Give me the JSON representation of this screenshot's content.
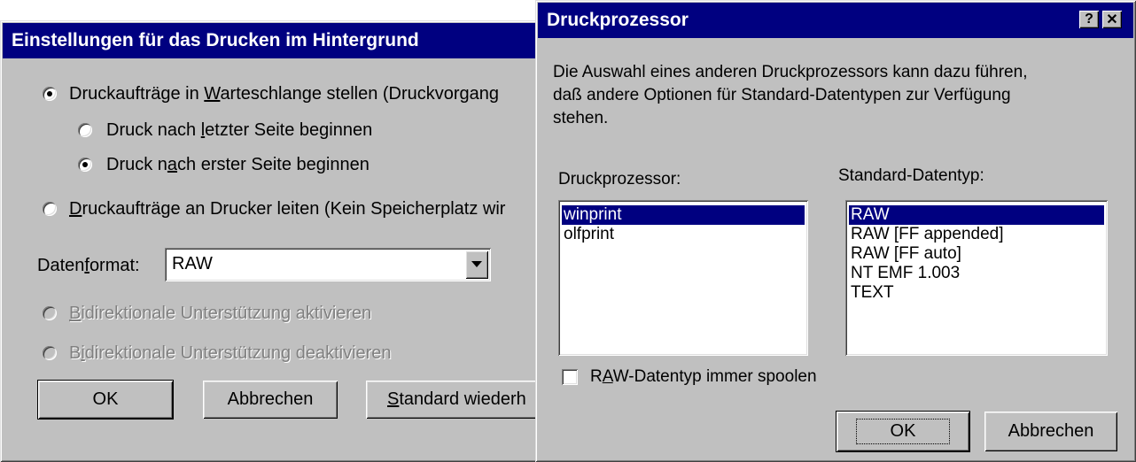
{
  "left_dialog": {
    "title": "Einstellungen für das Drucken im Hintergrund",
    "radio_spool": {
      "pre": "Druckaufträge in ",
      "acc": "W",
      "post": "arteschlange stellen (Druckvorgang"
    },
    "radio_after_last": {
      "pre": "Druck nach ",
      "acc": "l",
      "post": "etzter Seite beginnen"
    },
    "radio_after_first": {
      "pre": "Druck n",
      "acc": "a",
      "post": "ch erster Seite  beginnen"
    },
    "radio_direct": {
      "pre": "",
      "acc": "D",
      "post": "ruckaufträge an Drucker leiten (Kein Speicherplatz wir"
    },
    "format_label": {
      "pre": "Daten",
      "acc": "f",
      "post": "ormat:"
    },
    "format_value": "RAW",
    "bidi_enable": {
      "pre": "",
      "acc": "B",
      "post": "idirektionale Unterstützung aktivieren"
    },
    "bidi_disable": {
      "pre": "B",
      "acc": "i",
      "post": "direktionale Unterstützung deaktivieren"
    },
    "ok_label": "OK",
    "cancel_label": "Abbrechen",
    "restore_label": {
      "pre": "",
      "acc": "S",
      "post": "tandard wiederh"
    }
  },
  "right_dialog": {
    "title": "Druckprozessor",
    "help_btn": "?",
    "close_btn": "✕",
    "description": [
      "Die Auswahl eines anderen Druckprozessors kann dazu führen,",
      "daß andere Optionen für Standard-Datentypen zur Verfügung",
      "stehen."
    ],
    "processor_label": "Druckprozessor:",
    "datatype_label": "Standard-Datentyp:",
    "processors": [
      "winprint",
      "olfprint"
    ],
    "datatypes": [
      "RAW",
      "RAW [FF appended]",
      "RAW [FF auto]",
      "NT EMF 1.003",
      "TEXT"
    ],
    "checkbox_label": {
      "pre": "R",
      "acc": "A",
      "post": "W-Datentyp immer spoolen"
    },
    "ok_label": "OK",
    "cancel_label": "Abbrechen"
  },
  "colors": {
    "titlebar": "#000080",
    "face": "#c0c0c0",
    "selection": "#000080"
  }
}
